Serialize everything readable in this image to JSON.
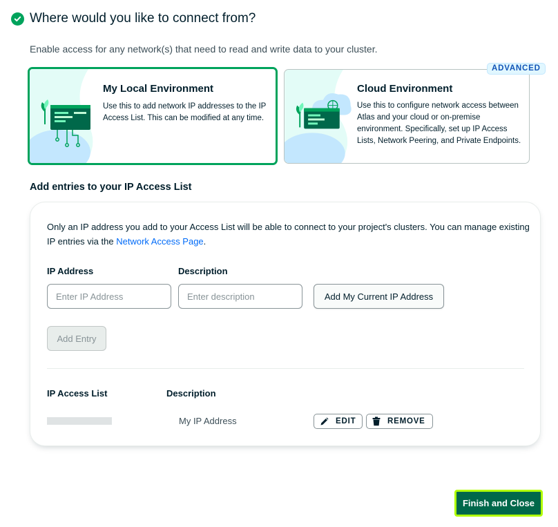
{
  "header": {
    "title": "Where would you like to connect from?",
    "subtitle": "Enable access for any network(s) that need to read and write data to your cluster."
  },
  "environments": {
    "local": {
      "title": "My Local Environment",
      "description": "Use this to add network IP addresses to the IP Access List. This can be modified at any time."
    },
    "cloud": {
      "badge": "ADVANCED",
      "title": "Cloud Environment",
      "description": "Use this to configure network access between Atlas and your cloud or on-premise environment. Specifically, set up IP Access Lists, Network Peering, and Private Endpoints."
    }
  },
  "access_list": {
    "section_title": "Add entries to your IP Access List",
    "info_text": "Only an IP address you add to your Access List will be able to connect to your project's clusters. You can manage existing IP entries via the ",
    "info_link": "Network Access Page",
    "info_end": ".",
    "ip_label": "IP Address",
    "ip_placeholder": "Enter IP Address",
    "desc_label": "Description",
    "desc_placeholder": "Enter description",
    "current_ip_button": "Add My Current IP Address",
    "add_entry_button": "Add Entry",
    "table": {
      "col_ip": "IP Access List",
      "col_desc": "Description",
      "rows": [
        {
          "description": "My IP Address",
          "edit": "EDIT",
          "remove": "REMOVE"
        }
      ]
    }
  },
  "footer": {
    "finish_button": "Finish and Close"
  },
  "colors": {
    "accent_green": "#00a35c",
    "dark_green": "#00684a",
    "focus_ring": "#b1ff05",
    "link": "#016bf8"
  },
  "icons": [
    "check-circle-icon",
    "pencil-icon",
    "trash-icon"
  ]
}
